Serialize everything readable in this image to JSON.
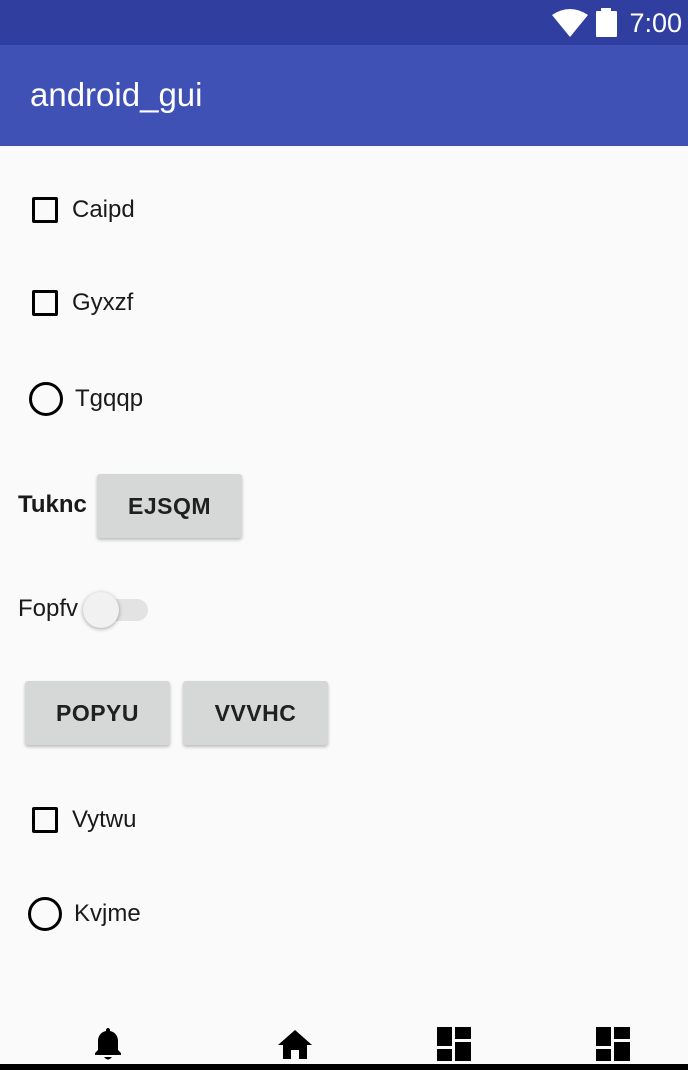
{
  "status_bar": {
    "time": "7:00",
    "icons": [
      "wifi-icon",
      "battery-icon"
    ],
    "background": "#303f9f"
  },
  "app_bar": {
    "title": "android_gui",
    "background": "#3f51b5"
  },
  "form": {
    "checkbox_1": {
      "label": "Caipd",
      "checked": false
    },
    "checkbox_2": {
      "label": "Gyxzf",
      "checked": false
    },
    "radio_1": {
      "label": "Tgqqp",
      "selected": false
    },
    "text_label": "Tuknc",
    "button_1": {
      "label": "EJSQM"
    },
    "switch": {
      "label": "Fopfv",
      "on": false
    },
    "button_2": {
      "label": "POPYU"
    },
    "button_3": {
      "label": "VVVHC"
    },
    "checkbox_3": {
      "label": "Vytwu",
      "checked": false
    },
    "radio_2": {
      "label": "Kvjme",
      "selected": false
    }
  },
  "bottom_nav": {
    "items": [
      {
        "icon": "bell-icon"
      },
      {
        "icon": "home-icon"
      },
      {
        "icon": "dashboard-icon"
      },
      {
        "icon": "dashboard-icon"
      }
    ]
  },
  "colors": {
    "button_bg": "#d6d7d7",
    "page_bg": "#fafafa"
  }
}
